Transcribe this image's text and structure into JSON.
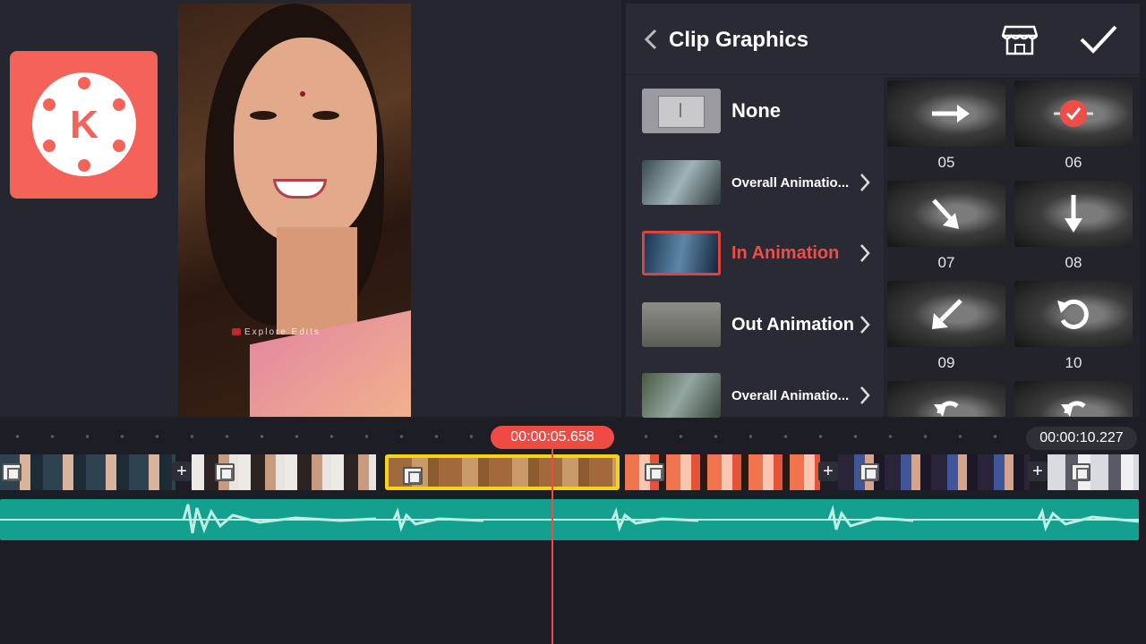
{
  "panel": {
    "title": "Clip Graphics",
    "back_icon": "chevron-left-icon",
    "store_icon": "store-icon",
    "confirm_icon": "check-icon",
    "menu": [
      {
        "label": "None",
        "active": false
      },
      {
        "label": "Overall Animatio...",
        "active": false
      },
      {
        "label": "In Animation",
        "active": true
      },
      {
        "label": "Out Animation",
        "active": false
      },
      {
        "label": "Overall Animatio...",
        "active": false
      }
    ],
    "animations": [
      {
        "number": "05",
        "icon": "arrow-right-icon"
      },
      {
        "number": "06",
        "icon": "checkmark-badge-icon",
        "selected": true
      },
      {
        "number": "07",
        "icon": "arrow-down-right-icon"
      },
      {
        "number": "08",
        "icon": "arrow-down-icon"
      },
      {
        "number": "09",
        "icon": "arrow-down-left-icon"
      },
      {
        "number": "10",
        "icon": "rotate-icon"
      }
    ],
    "accent_color": "#ef4d47"
  },
  "preview": {
    "watermark": "Explore Edits",
    "logo_letter": "K"
  },
  "timeline": {
    "current_time": "00:00:05.658",
    "total_time": "00:00:10.227",
    "selected_clip_color": "#f7d21a",
    "audio_color": "#13a08f"
  }
}
